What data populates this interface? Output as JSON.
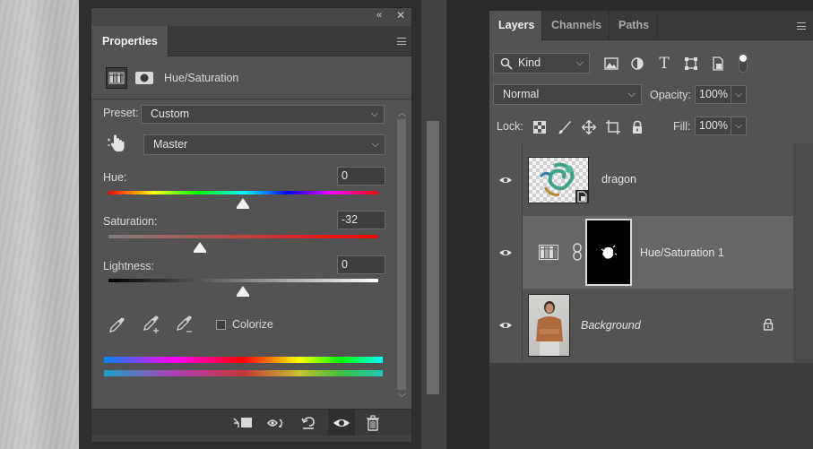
{
  "properties": {
    "tab_label": "Properties",
    "adjustment_title": "Hue/Saturation",
    "preset_label": "Preset:",
    "preset_value": "Custom",
    "channel_value": "Master",
    "hue_label": "Hue:",
    "hue_value": "0",
    "saturation_label": "Saturation:",
    "saturation_value": "-32",
    "lightness_label": "Lightness:",
    "lightness_value": "0",
    "colorize_label": "Colorize",
    "colorize_checked": false
  },
  "layers_panel": {
    "tabs": [
      {
        "label": "Layers",
        "active": true
      },
      {
        "label": "Channels",
        "active": false
      },
      {
        "label": "Paths",
        "active": false
      }
    ],
    "filter_kind": "Kind",
    "blend_mode": "Normal",
    "opacity_label": "Opacity:",
    "opacity_value": "100%",
    "lock_label": "Lock:",
    "fill_label": "Fill:",
    "fill_value": "100%",
    "layers": [
      {
        "name": "dragon",
        "type": "smart-object",
        "visible": true,
        "selected": false
      },
      {
        "name": "Hue/Saturation 1",
        "type": "adjustment",
        "visible": true,
        "selected": true
      },
      {
        "name": "Background",
        "type": "background",
        "visible": true,
        "selected": false,
        "locked": true
      }
    ]
  },
  "colors": {
    "panel_bg": "#535353",
    "dock_bg": "#2f2f2f",
    "selected_layer": "#676767",
    "text": "#d6d6d6"
  }
}
